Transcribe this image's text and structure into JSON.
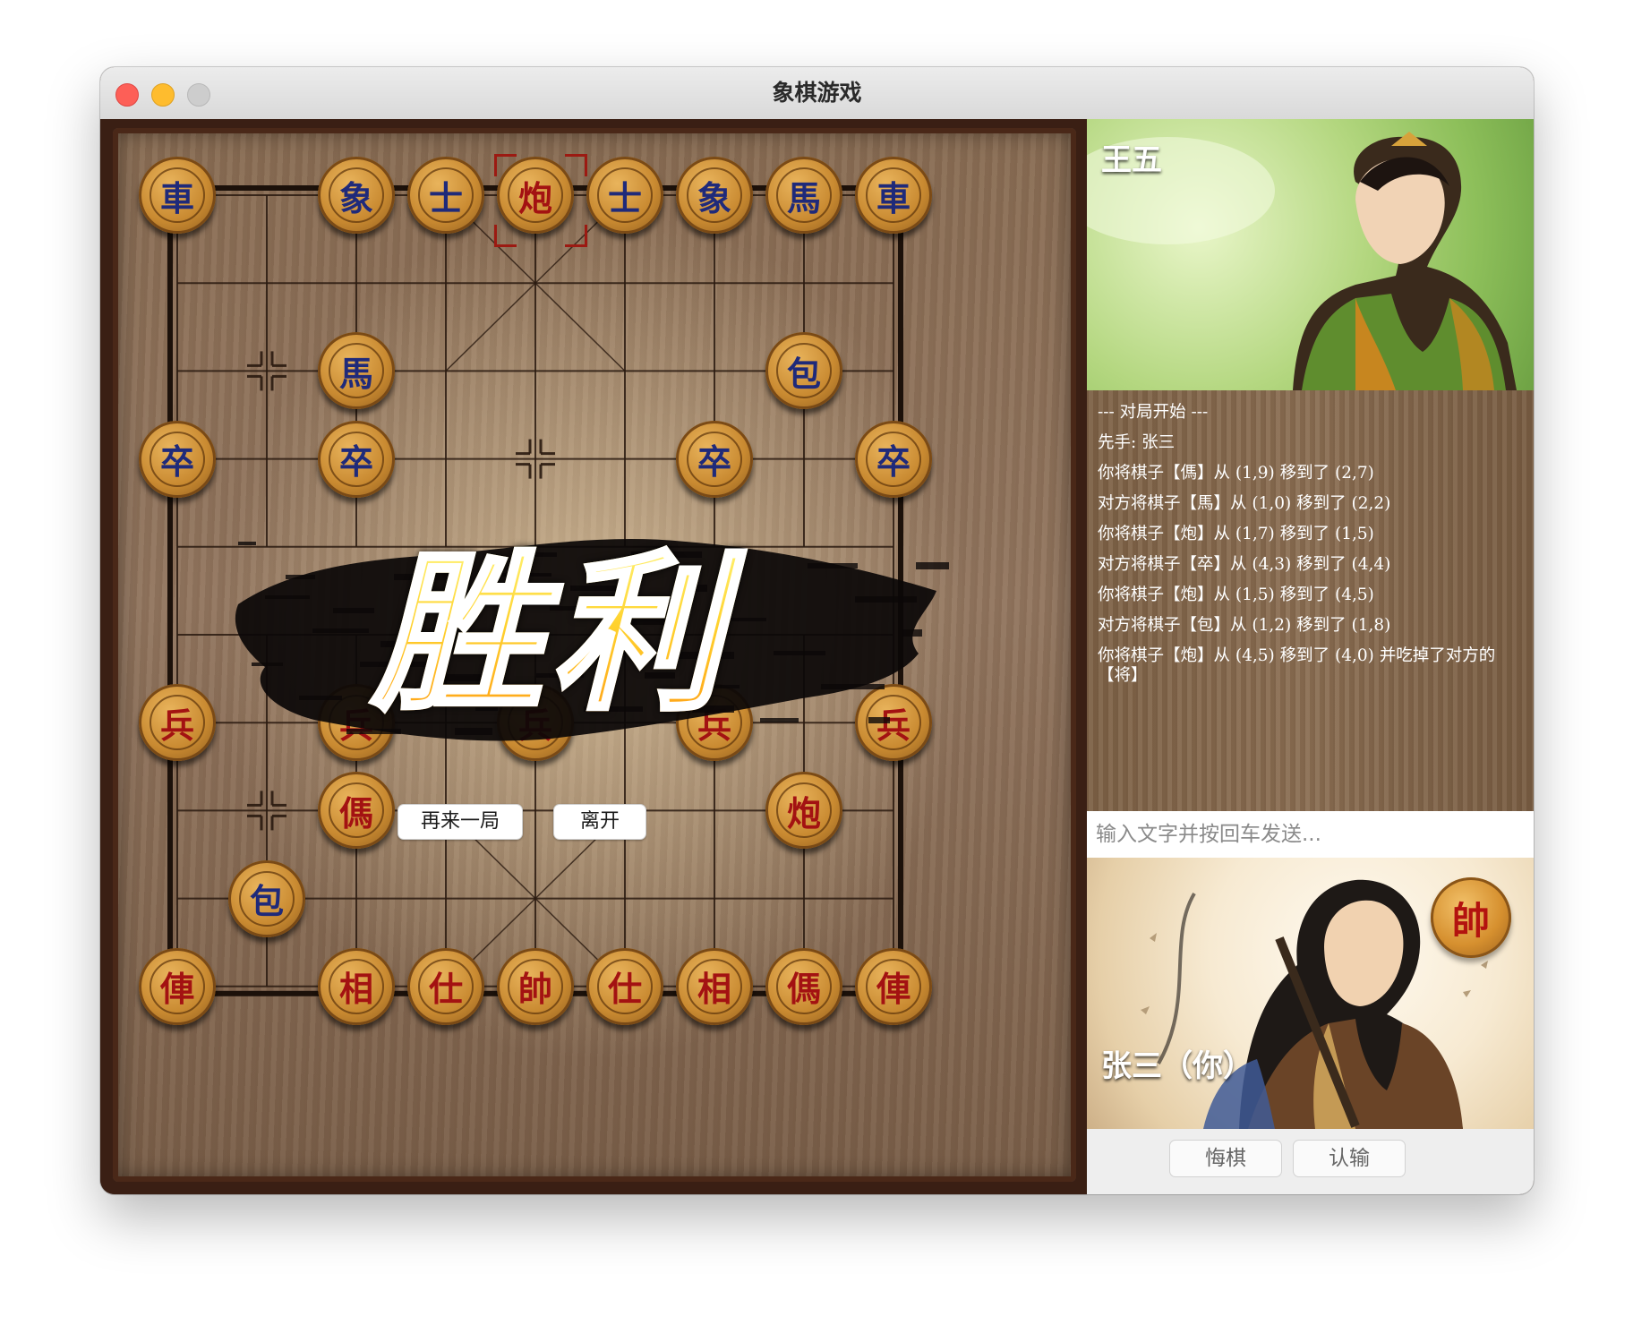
{
  "window": {
    "title": "象棋游戏"
  },
  "board": {
    "pieces": [
      {
        "char": "車",
        "side": "black",
        "col": 0,
        "row": 0
      },
      {
        "char": "象",
        "side": "black",
        "col": 2,
        "row": 0
      },
      {
        "char": "士",
        "side": "black",
        "col": 3,
        "row": 0
      },
      {
        "char": "炮",
        "side": "red",
        "col": 4,
        "row": 0
      },
      {
        "char": "士",
        "side": "black",
        "col": 5,
        "row": 0
      },
      {
        "char": "象",
        "side": "black",
        "col": 6,
        "row": 0
      },
      {
        "char": "馬",
        "side": "black",
        "col": 7,
        "row": 0
      },
      {
        "char": "車",
        "side": "black",
        "col": 8,
        "row": 0
      },
      {
        "char": "馬",
        "side": "black",
        "col": 2,
        "row": 2
      },
      {
        "char": "包",
        "side": "black",
        "col": 7,
        "row": 2
      },
      {
        "char": "卒",
        "side": "black",
        "col": 0,
        "row": 3
      },
      {
        "char": "卒",
        "side": "black",
        "col": 2,
        "row": 3
      },
      {
        "char": "卒",
        "side": "black",
        "col": 6,
        "row": 3
      },
      {
        "char": "卒",
        "side": "black",
        "col": 8,
        "row": 3
      },
      {
        "char": "兵",
        "side": "red",
        "col": 0,
        "row": 6
      },
      {
        "char": "兵",
        "side": "red",
        "col": 2,
        "row": 6
      },
      {
        "char": "兵",
        "side": "red",
        "col": 4,
        "row": 6
      },
      {
        "char": "兵",
        "side": "red",
        "col": 6,
        "row": 6
      },
      {
        "char": "兵",
        "side": "red",
        "col": 8,
        "row": 6
      },
      {
        "char": "傌",
        "side": "red",
        "col": 2,
        "row": 7
      },
      {
        "char": "炮",
        "side": "red",
        "col": 7,
        "row": 7
      },
      {
        "char": "包",
        "side": "black",
        "col": 1,
        "row": 8
      },
      {
        "char": "俥",
        "side": "red",
        "col": 0,
        "row": 9
      },
      {
        "char": "相",
        "side": "red",
        "col": 2,
        "row": 9
      },
      {
        "char": "仕",
        "side": "red",
        "col": 3,
        "row": 9
      },
      {
        "char": "帥",
        "side": "red",
        "col": 4,
        "row": 9
      },
      {
        "char": "仕",
        "side": "red",
        "col": 5,
        "row": 9
      },
      {
        "char": "相",
        "side": "red",
        "col": 6,
        "row": 9
      },
      {
        "char": "傌",
        "side": "red",
        "col": 7,
        "row": 9
      },
      {
        "char": "俥",
        "side": "red",
        "col": 8,
        "row": 9
      }
    ],
    "selected": {
      "col": 4,
      "row": 0
    }
  },
  "overlay": {
    "victory_text": "胜利",
    "replay_label": "再来一局",
    "leave_label": "离开"
  },
  "opponent": {
    "name": "王五"
  },
  "log": [
    "--- 对局开始 ---",
    "先手: 张三",
    "你将棋子【傌】从 (1,9) 移到了 (2,7)",
    "对方将棋子【馬】从 (1,0) 移到了 (2,2)",
    "你将棋子【炮】从 (1,7) 移到了 (1,5)",
    "对方将棋子【卒】从 (4,3) 移到了 (4,4)",
    "你将棋子【炮】从 (1,5) 移到了 (4,5)",
    "对方将棋子【包】从 (1,2) 移到了 (1,8)",
    "你将棋子【炮】从 (4,5) 移到了 (4,0) 并吃掉了对方的【将】"
  ],
  "chat": {
    "placeholder": "输入文字并按回车发送..."
  },
  "player": {
    "name": "张三（你）",
    "badge": "帥"
  },
  "controls": {
    "undo_label": "悔棋",
    "resign_label": "认输"
  }
}
